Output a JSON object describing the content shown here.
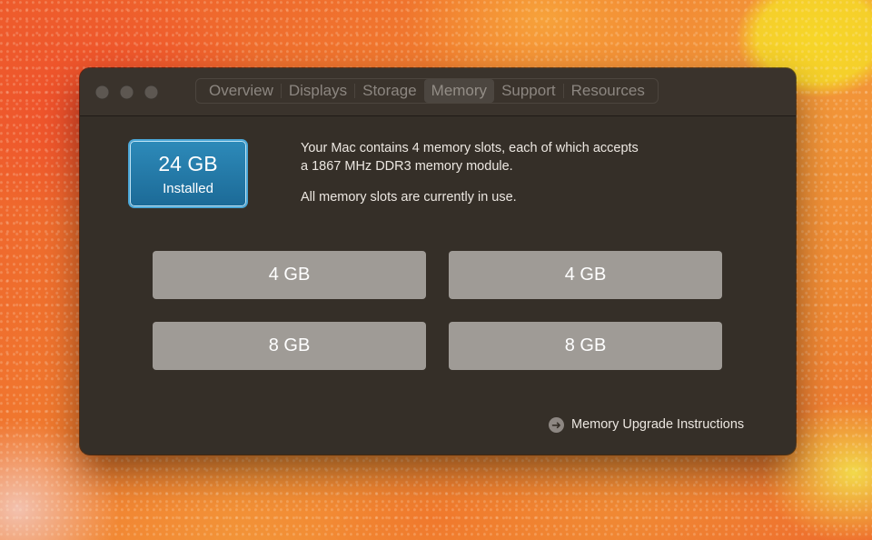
{
  "window": {
    "controls": [
      "close",
      "minimize",
      "zoom"
    ]
  },
  "tabs": [
    {
      "label": "Overview",
      "active": false
    },
    {
      "label": "Displays",
      "active": false
    },
    {
      "label": "Storage",
      "active": false
    },
    {
      "label": "Memory",
      "active": true
    },
    {
      "label": "Support",
      "active": false
    },
    {
      "label": "Resources",
      "active": false
    }
  ],
  "memory": {
    "installed_size": "24 GB",
    "installed_label": "Installed",
    "description_line1": "Your Mac contains 4 memory slots, each of which accepts",
    "description_line2": "a 1867 MHz DDR3 memory module.",
    "status": "All memory slots are currently in use.",
    "slots": [
      {
        "size": "4 GB"
      },
      {
        "size": "4 GB"
      },
      {
        "size": "8 GB"
      },
      {
        "size": "8 GB"
      }
    ],
    "upgrade_link": "Memory Upgrade Instructions",
    "upgrade_icon": "arrow-right-circle-icon"
  },
  "colors": {
    "window_bg": "#352f28",
    "badge_blue": "#1c6a97",
    "slot_gray": "#9f9b96"
  }
}
